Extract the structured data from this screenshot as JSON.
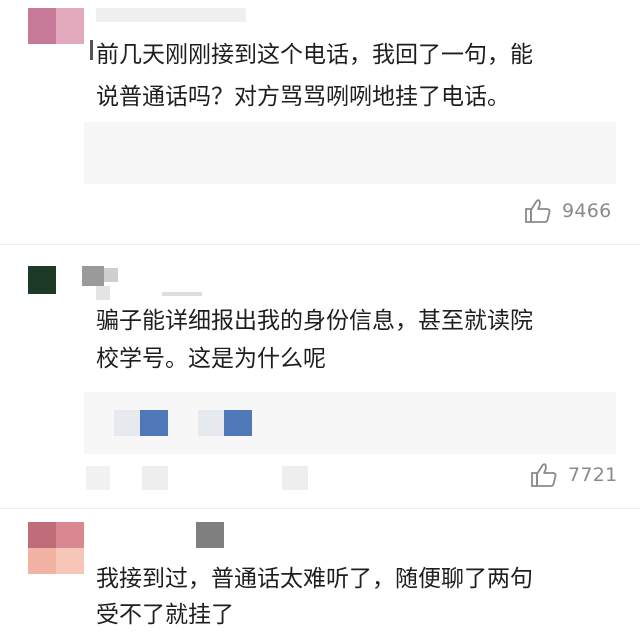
{
  "comments": [
    {
      "text_lines": [
        "前几天刚刚接到这个电话，我回了一句，能",
        "说普通话吗？对方骂骂咧咧地挂了电话。"
      ],
      "likes": "9466"
    },
    {
      "text_lines": [
        "骗子能详细报出我的身份信息，甚至就读院",
        "校学号。这是为什么呢"
      ],
      "likes": "7721"
    },
    {
      "text_lines": [
        "我接到过，普通话太难听了，随便聊了两句",
        "受不了就挂了"
      ]
    }
  ],
  "colors": {
    "avatar1_a": "#c77a98",
    "avatar1_b": "#e3a9bd",
    "avatar2": "#1c3a26",
    "avatar3_a": "#c16c79",
    "avatar3_b": "#f2b3a4",
    "card_bg": "#f7f7f7",
    "blue_block": "#4f78b8",
    "gray_block": "#8a8a8a"
  },
  "icons": {
    "like": "thumbs-up-icon"
  }
}
